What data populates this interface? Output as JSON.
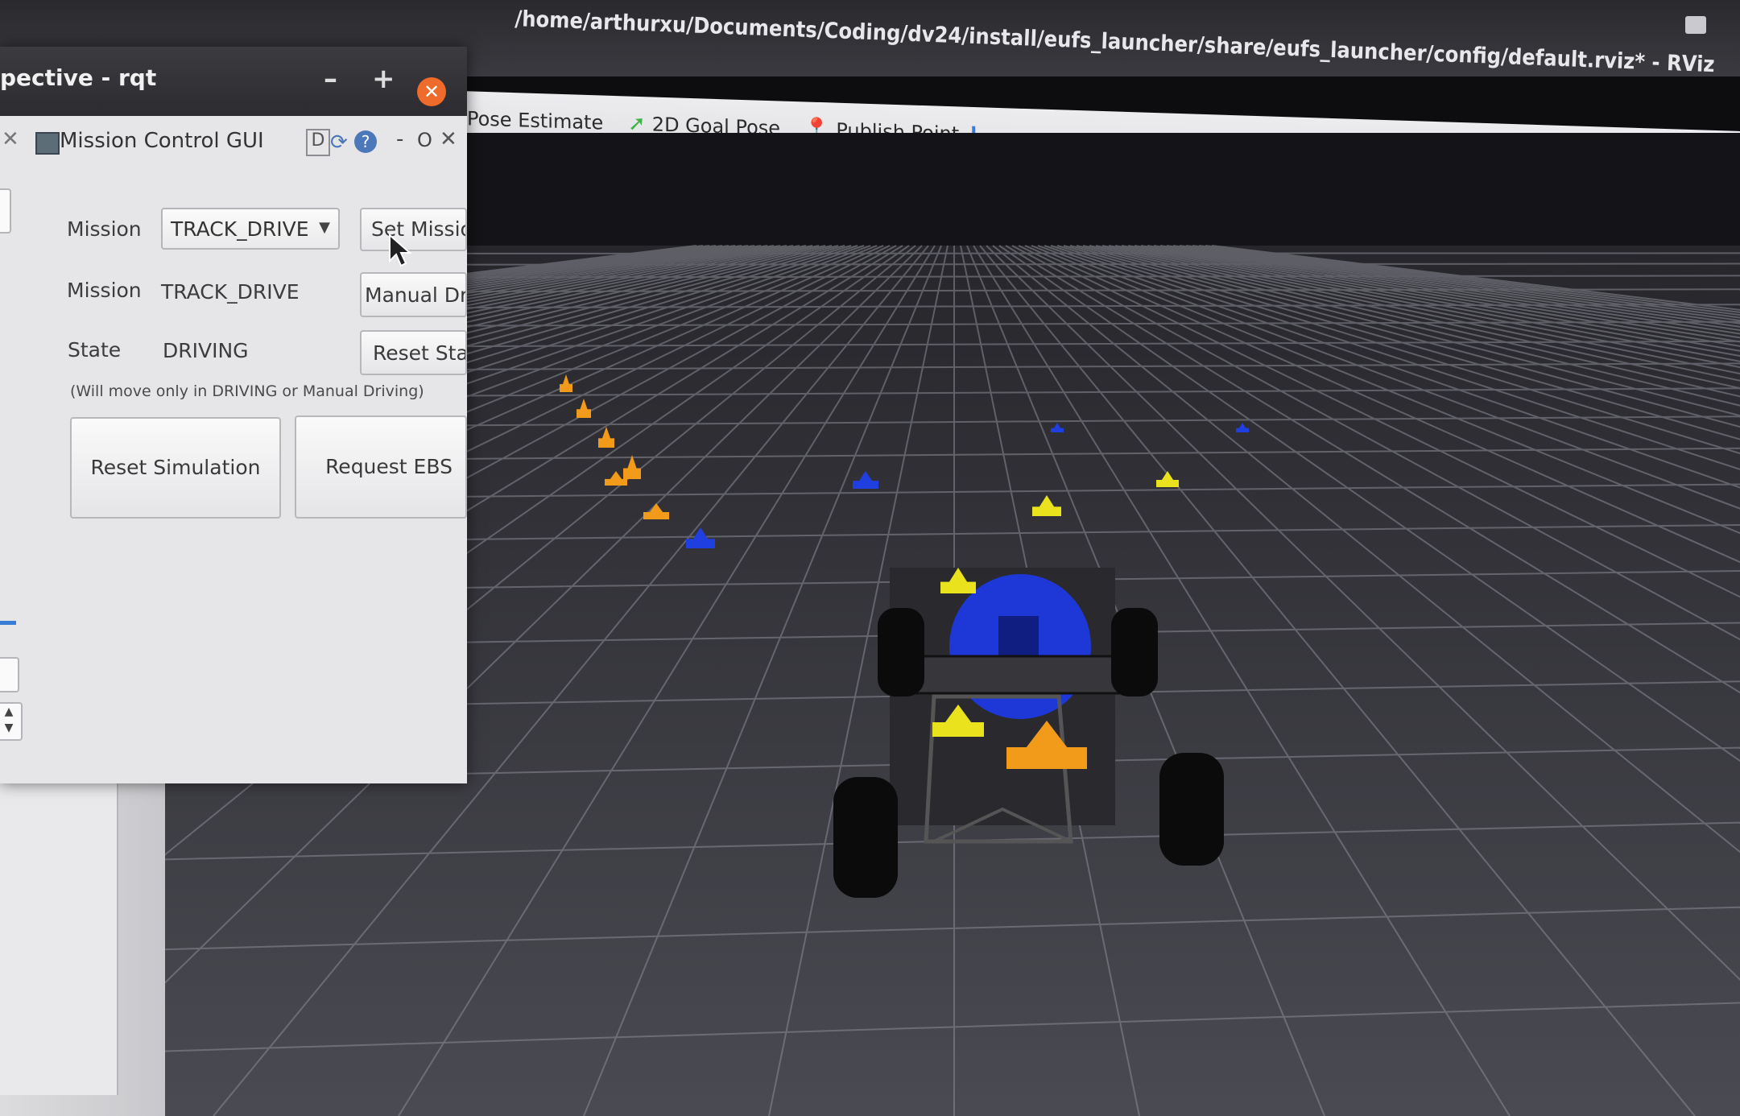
{
  "rviz": {
    "title": "/home/arthurxu/Documents/Coding/dv24/install/eufs_launcher/share/eufs_launcher/config/default.rviz* - RViz",
    "toolbar": {
      "pose_estimate": "Pose Estimate",
      "goal_pose": "2D Goal Pose",
      "publish_point": "Publish Point",
      "add_tool": "+",
      "remove_tool": "−"
    }
  },
  "rqt": {
    "window_title": "pective - rqt",
    "plugin_title": "Mission Control GUI",
    "plugin_d_label": "D",
    "plugin_dash": "-",
    "plugin_o": "O",
    "mission_label": "Mission",
    "mission_select_value": "TRACK_DRIVE",
    "set_mission_button": "Set Missio",
    "current_mission_label": "Mission",
    "current_mission_value": "TRACK_DRIVE",
    "manual_driving_button": "Manual Dr",
    "state_label": "State",
    "state_value": "DRIVING",
    "reset_state_button": "Reset Sta",
    "note": "(Will move only in DRIVING or Manual Driving)",
    "reset_simulation_button": "Reset Simulation",
    "request_ebs_button": "Request EBS"
  },
  "colors": {
    "blue_cone": "#1f3fe0",
    "yellow_cone": "#e9e21c",
    "orange_cone": "#f29a1a",
    "grid_line": "#8a8a94",
    "floor": "#3b3b41"
  }
}
